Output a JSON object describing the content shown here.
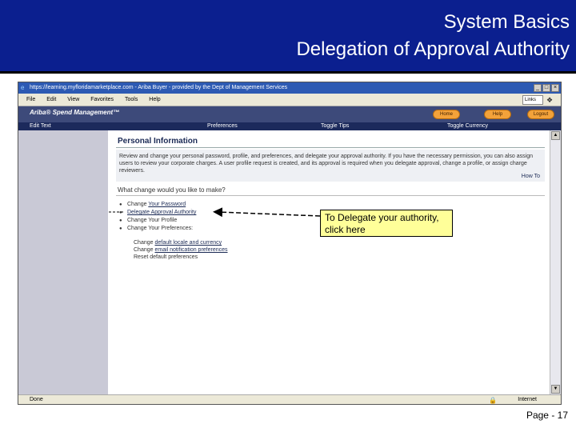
{
  "slide": {
    "title_line1": "System Basics",
    "title_line2": "Delegation of Approval Authority",
    "page_label": "Page - 17"
  },
  "browser": {
    "title": "https://learning.myfloridamarketplace.com - Ariba Buyer - provided by the Dept of Management Services",
    "menu": [
      "File",
      "Edit",
      "View",
      "Favorites",
      "Tools",
      "Help"
    ],
    "links_label": "Links",
    "status_left": "Done",
    "status_right": "Internet"
  },
  "app": {
    "brand": "Ariba® Spend Management™",
    "buttons": [
      "Home",
      "Help",
      "Logout"
    ],
    "nav": {
      "left": "Edit Text",
      "preferences": "Preferences",
      "toggle_tips": "Toggle Tips",
      "toggle_currency": "Toggle Currency"
    }
  },
  "content": {
    "section_title": "Personal Information",
    "intro": "Review and change your personal password, profile, and preferences, and delegate your approval authority. If you have the necessary permission, you can also assign users to review your corporate charges. A user profile request is created, and its approval is required when you delegate approval, change a profile, or assign charge reviewers.",
    "how_to": "How To",
    "question": "What change would you like to make?",
    "options": [
      {
        "prefix": "Change ",
        "link": "Your Password"
      },
      {
        "prefix": "",
        "link": "Delegate Approval Authority"
      },
      {
        "prefix": "Change Your Profile",
        "link": ""
      },
      {
        "prefix": "Change Your Preferences:",
        "link": ""
      }
    ],
    "sub_options": [
      {
        "prefix": "Change ",
        "link": "default locale and currency"
      },
      {
        "prefix": "Change ",
        "link": "email notification preferences"
      },
      {
        "prefix": "Reset default preferences",
        "link": ""
      }
    ]
  },
  "callout": {
    "text": "To Delegate your authority, click here"
  }
}
